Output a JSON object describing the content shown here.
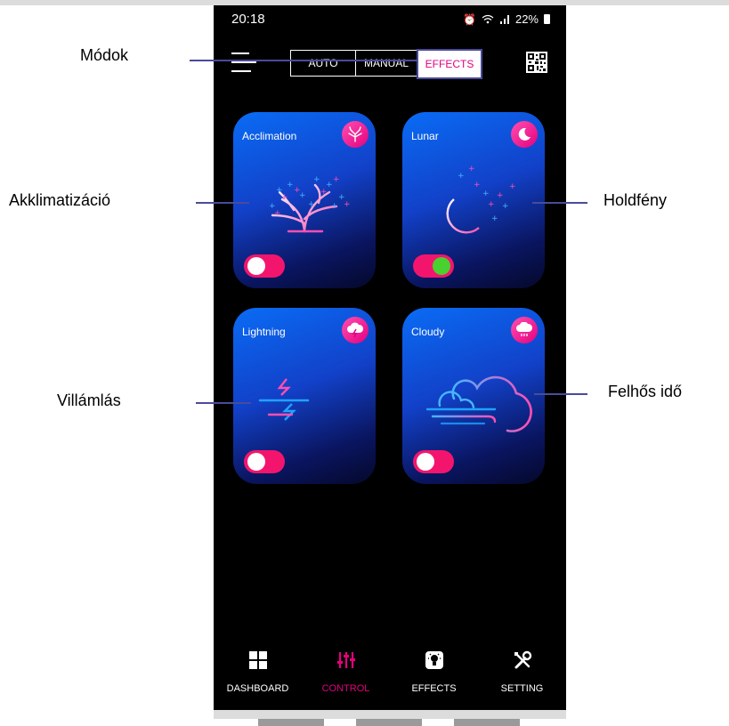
{
  "status": {
    "time": "20:18",
    "battery": "22%",
    "icons": [
      "alarm-icon",
      "wifi-icon",
      "signal-icon"
    ]
  },
  "header": {
    "menu_icon": "hamburger-icon",
    "modes": [
      {
        "label": "AUTO",
        "active": false
      },
      {
        "label": "MANUAL",
        "active": false
      },
      {
        "label": "EFFECTS",
        "active": true
      }
    ],
    "qr_icon": "qr-code-icon"
  },
  "cards": [
    {
      "title": "Acclimation",
      "icon": "tree-icon",
      "enabled": false
    },
    {
      "title": "Lunar",
      "icon": "moon-icon",
      "enabled": true
    },
    {
      "title": "Lightning",
      "icon": "storm-cloud-icon",
      "enabled": false
    },
    {
      "title": "Cloudy",
      "icon": "rain-cloud-icon",
      "enabled": false
    }
  ],
  "nav": [
    {
      "label": "DASHBOARD",
      "icon": "grid-icon",
      "active": false
    },
    {
      "label": "CONTROL",
      "icon": "sliders-icon",
      "active": true
    },
    {
      "label": "EFFECTS",
      "icon": "lightbulb-icon",
      "active": false
    },
    {
      "label": "SETTING",
      "icon": "tools-icon",
      "active": false
    }
  ],
  "annotations": {
    "modes": "Módok",
    "acclimation": "Akklimatizáció",
    "lunar": "Holdfény",
    "lightning": "Villámlás",
    "cloudy": "Felhős idő"
  },
  "colors": {
    "accent": "#e4007e",
    "annotation_line": "#4a4b9a",
    "toggle_on": "#49d12f",
    "toggle_track": "#f3156d"
  }
}
